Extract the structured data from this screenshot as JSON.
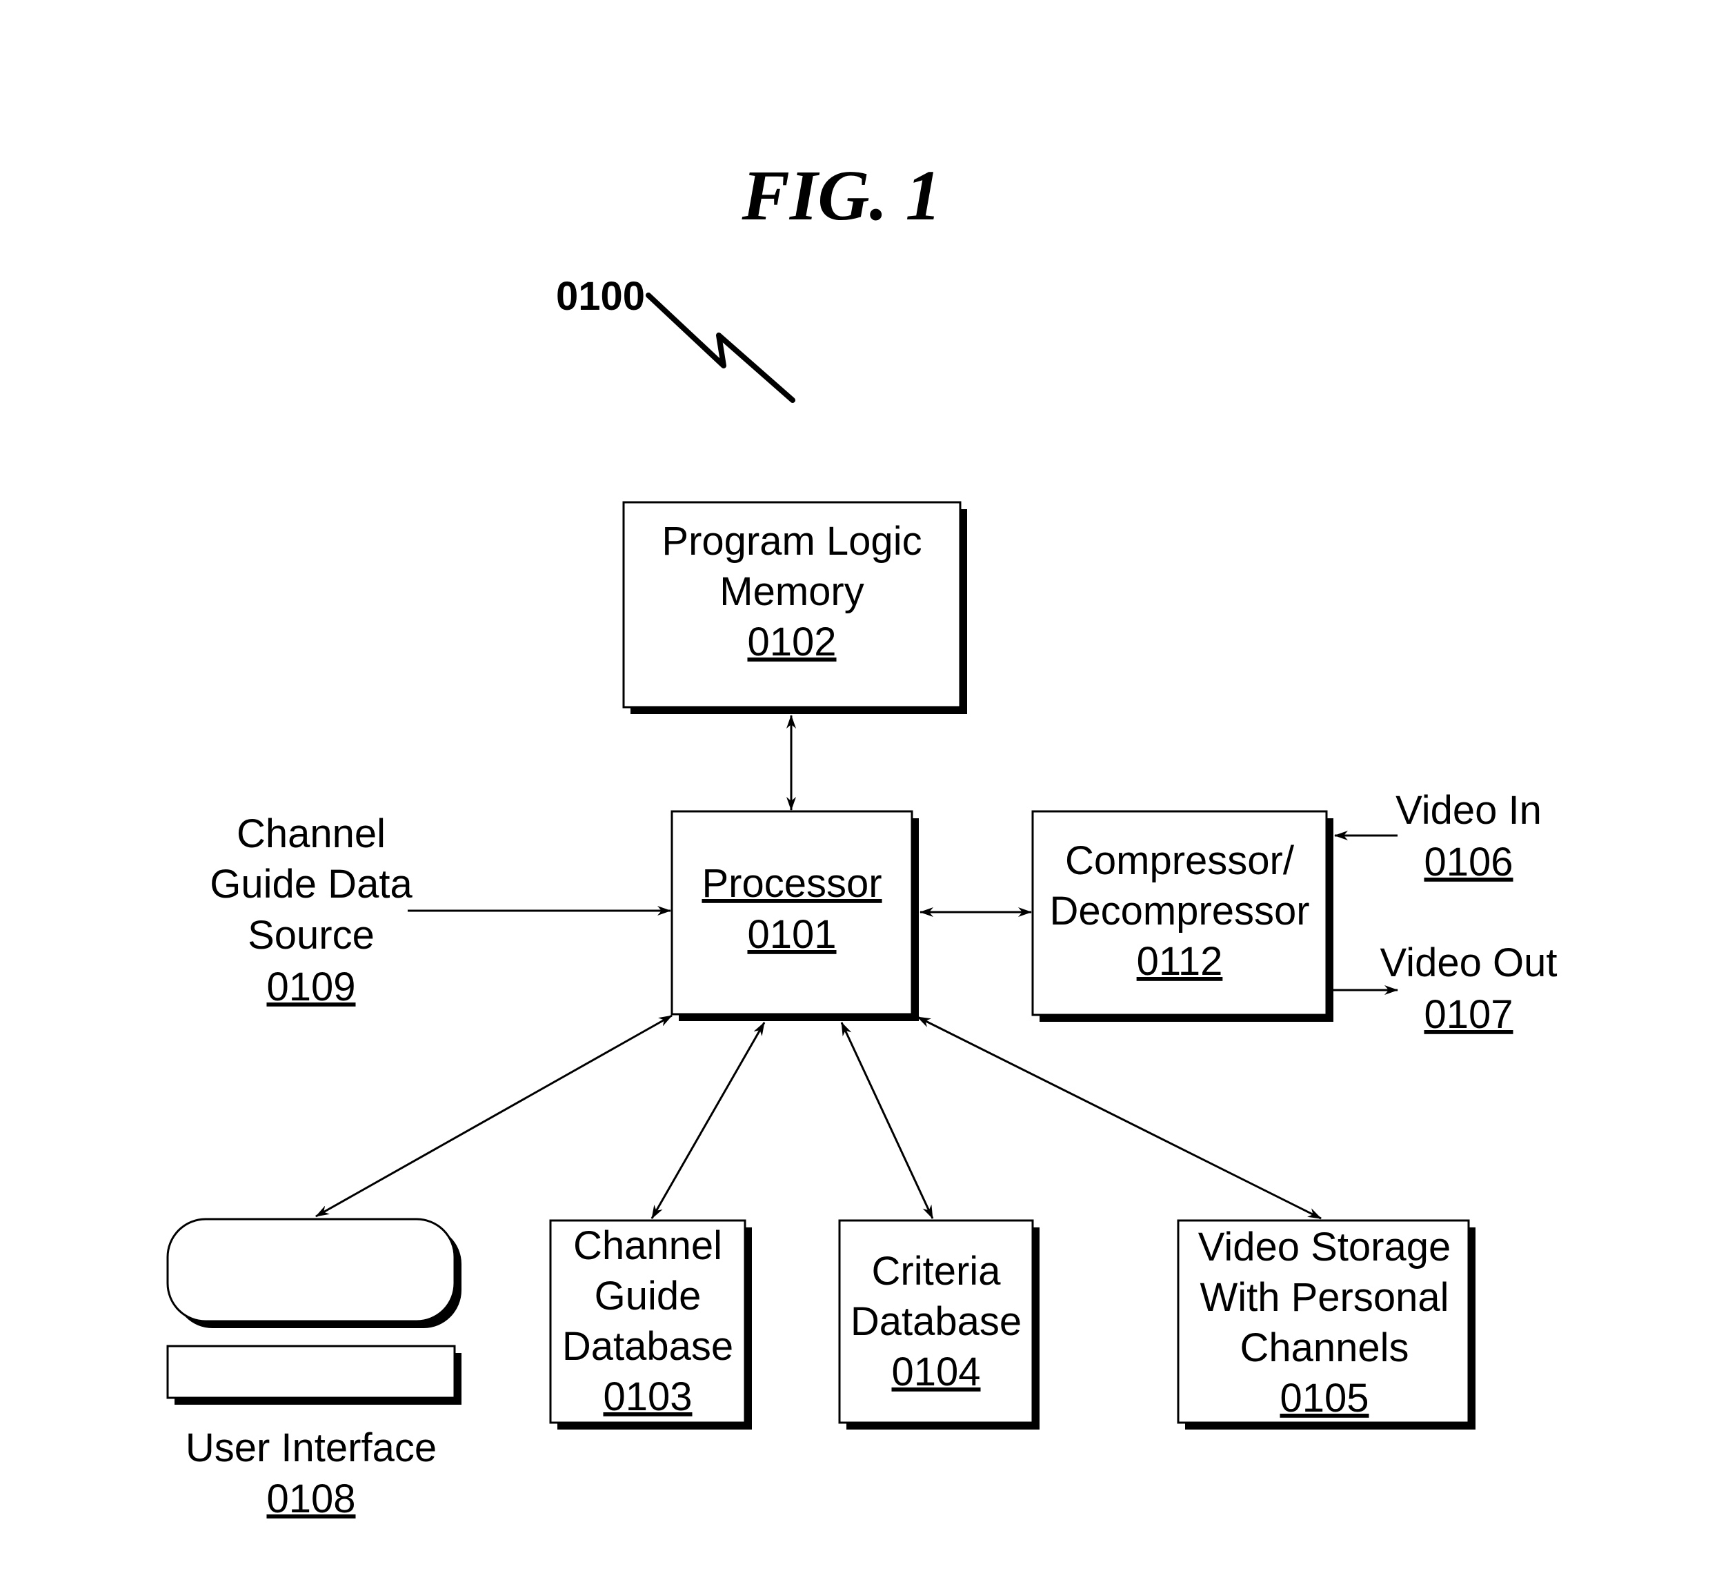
{
  "figure": {
    "title": "FIG. 1",
    "reference": "0100"
  },
  "nodes": {
    "program_logic_memory": {
      "lines": [
        "Program Logic",
        "Memory"
      ],
      "ref": "0102"
    },
    "processor": {
      "lines": [
        "Processor"
      ],
      "ref": "0101"
    },
    "compressor": {
      "lines": [
        "Compressor/",
        "Decompressor"
      ],
      "ref": "0112"
    },
    "channel_guide_data_source": {
      "lines": [
        "Channel",
        "Guide Data",
        "Source"
      ],
      "ref": "0109"
    },
    "video_in": {
      "lines": [
        "Video In"
      ],
      "ref": "0106"
    },
    "video_out": {
      "lines": [
        "Video Out"
      ],
      "ref": "0107"
    },
    "user_interface": {
      "lines": [
        "User Interface"
      ],
      "ref": "0108"
    },
    "channel_guide_database": {
      "lines": [
        "Channel",
        "Guide",
        "Database"
      ],
      "ref": "0103"
    },
    "criteria_database": {
      "lines": [
        "Criteria",
        "Database"
      ],
      "ref": "0104"
    },
    "video_storage": {
      "lines": [
        "Video Storage",
        "With Personal",
        "Channels"
      ],
      "ref": "0105"
    }
  },
  "connections": [
    {
      "from": "program_logic_memory",
      "to": "processor",
      "direction": "bidirectional"
    },
    {
      "from": "channel_guide_data_source",
      "to": "processor",
      "direction": "forward"
    },
    {
      "from": "processor",
      "to": "compressor",
      "direction": "bidirectional"
    },
    {
      "from": "video_in",
      "to": "compressor",
      "direction": "forward"
    },
    {
      "from": "compressor",
      "to": "video_out",
      "direction": "forward"
    },
    {
      "from": "processor",
      "to": "user_interface",
      "direction": "bidirectional"
    },
    {
      "from": "processor",
      "to": "channel_guide_database",
      "direction": "bidirectional"
    },
    {
      "from": "processor",
      "to": "criteria_database",
      "direction": "bidirectional"
    },
    {
      "from": "processor",
      "to": "video_storage",
      "direction": "bidirectional"
    }
  ]
}
